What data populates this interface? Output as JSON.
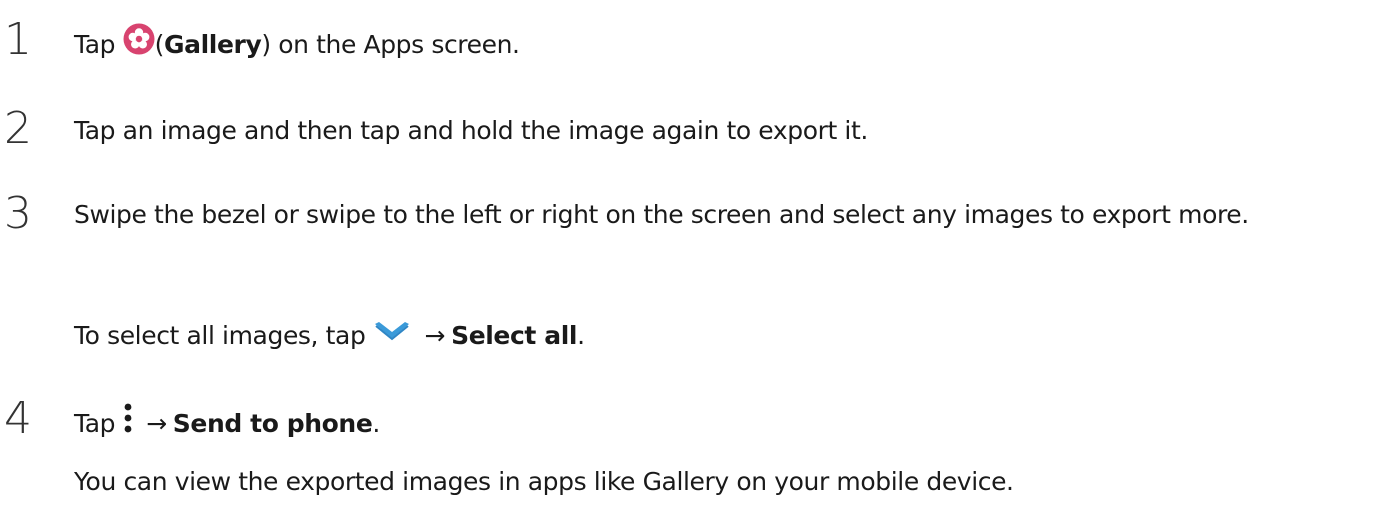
{
  "steps": [
    {
      "number": "1",
      "prefix": "Tap",
      "icon": "gallery-icon",
      "paren_open": "(",
      "bold": "Gallery",
      "suffix": ") on the Apps screen."
    },
    {
      "number": "2",
      "text": "Tap an image and then tap and hold the image again to export it."
    },
    {
      "number": "3",
      "text": "Swipe the bezel or swipe to the left or right on the screen and select any images to export more.",
      "note": {
        "prefix": "To select all images, tap",
        "icon": "chevron-down-icon",
        "arrow": "→",
        "bold": "Select all",
        "suffix": "."
      }
    },
    {
      "number": "4",
      "prefix": "Tap",
      "icon": "more-options-icon",
      "arrow": "→",
      "bold": "Send to phone",
      "suffix": ".",
      "note": "You can view the exported images in apps like Gallery on your mobile device."
    }
  ],
  "colors": {
    "gallery_icon": "#d8436f",
    "chevron_icon": "#3a9ad9",
    "text": "#1a1a1a"
  }
}
